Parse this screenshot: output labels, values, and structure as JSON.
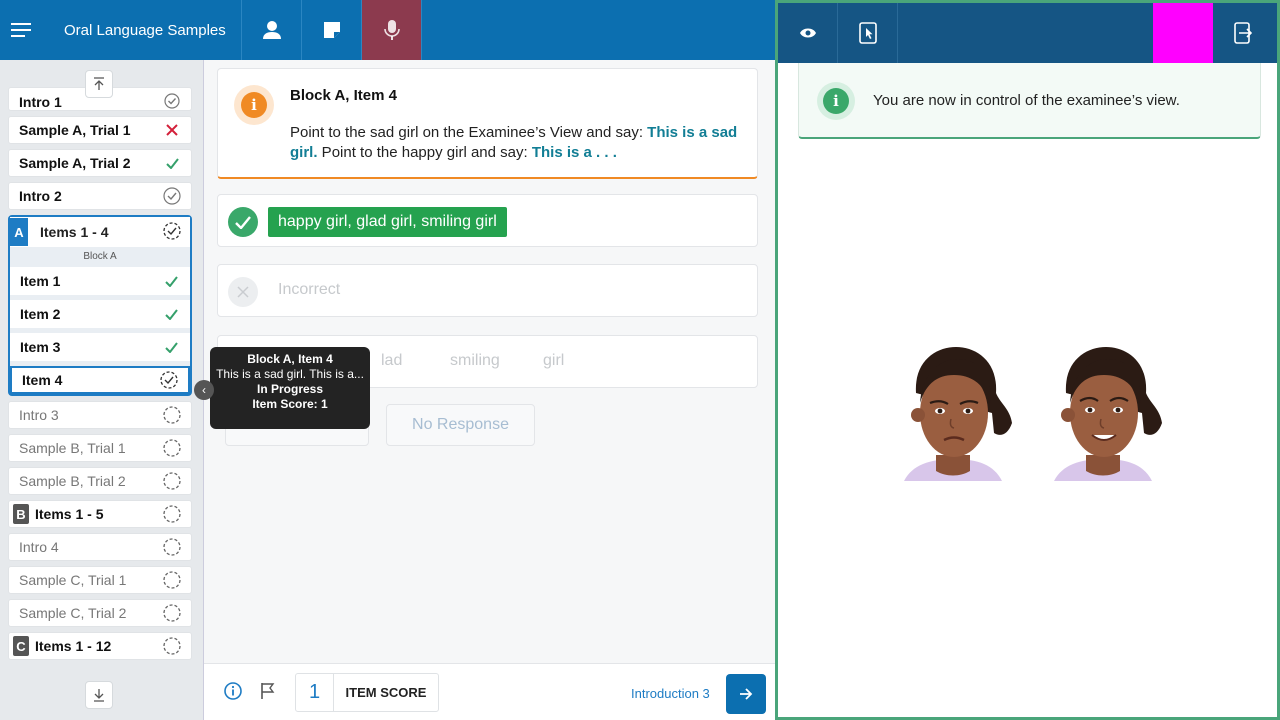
{
  "header": {
    "title": "Oral Language Samples",
    "buttons": [
      "menu-icon",
      "person-icon",
      "note-icon",
      "microphone-icon"
    ]
  },
  "sidebar": {
    "items_top": [
      {
        "label": "Intro 1",
        "status": "done-check-circle",
        "style": "bold",
        "cut": true
      },
      {
        "label": "Sample A, Trial 1",
        "status": "incorrect",
        "style": "bold"
      },
      {
        "label": "Sample A, Trial 2",
        "status": "correct",
        "style": "bold"
      },
      {
        "label": "Intro 2",
        "status": "done-check-circle",
        "style": "bold"
      }
    ],
    "block_a": {
      "badge": "A",
      "title": "Items 1 - 4",
      "subtitle": "Block A",
      "items": [
        {
          "label": "Item 1",
          "status": "correct"
        },
        {
          "label": "Item 2",
          "status": "correct"
        },
        {
          "label": "Item 3",
          "status": "correct"
        },
        {
          "label": "Item 4",
          "status": "in-progress"
        }
      ]
    },
    "items_bottom": [
      {
        "label": "Intro 3",
        "style": "dim"
      },
      {
        "label": "Sample B, Trial 1",
        "style": "dim"
      },
      {
        "label": "Sample B, Trial 2",
        "style": "dim"
      },
      {
        "label": "Items 1 - 5",
        "style": "bold",
        "badge": "B"
      },
      {
        "label": "Intro 4",
        "style": "dim"
      },
      {
        "label": "Sample C, Trial 1",
        "style": "dim"
      },
      {
        "label": "Sample C, Trial 2",
        "style": "dim"
      },
      {
        "label": "Items 1 - 12",
        "style": "bold",
        "badge": "C"
      }
    ]
  },
  "question": {
    "title": "Block A, Item 4",
    "text_1": "Point to the sad girl on the Examinee’s View and say: ",
    "bold_1": "This is a sad girl.",
    "text_2": " Point to the happy girl and say: ",
    "bold_2": "This is a . . ."
  },
  "responses": {
    "correct_answer": "happy girl, glad girl, smiling girl",
    "incorrect_label": "Incorrect",
    "words": [
      "lad",
      "smiling",
      "girl"
    ],
    "other_button": "I Don't Know",
    "no_response": "No Response"
  },
  "tooltip": {
    "title": "Block A, Item 4",
    "text": "This is a sad girl. This is a...",
    "status": "In Progress",
    "score": "Item Score: 1"
  },
  "footer": {
    "item_score_value": "1",
    "item_score_label": "ITEM SCORE",
    "next_label": "Introduction 3"
  },
  "examinee": {
    "notice": "You are now in control of the examinee’s view.",
    "buttons": [
      "eye-icon",
      "tablet-pointer-icon",
      "exit-icon"
    ],
    "highlight_color": "#ff00ff"
  },
  "colors": {
    "primary": "#0c6fb0",
    "active_mic": "#8c3a4e",
    "correct": "#25a24f",
    "warning": "#f08a24",
    "pane_border": "#4aa57a"
  }
}
